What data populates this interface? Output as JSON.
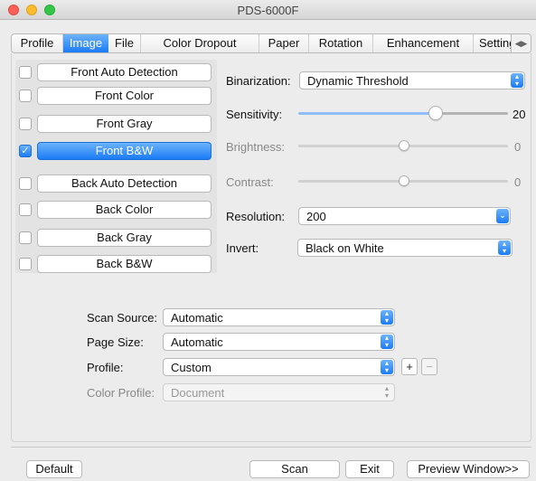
{
  "window": {
    "title": "PDS-6000F",
    "traffic_lights": {
      "close": "#fc5f57",
      "minimize": "#fdbc2e",
      "maximize": "#33c748"
    }
  },
  "tabs": [
    {
      "label": "Profile",
      "active": false
    },
    {
      "label": "Image",
      "active": true
    },
    {
      "label": "File",
      "active": false
    },
    {
      "label": "Color Dropout",
      "active": false
    },
    {
      "label": "Paper",
      "active": false
    },
    {
      "label": "Rotation",
      "active": false
    },
    {
      "label": "Enhancement",
      "active": false
    },
    {
      "label": "Setting",
      "active": false
    }
  ],
  "tab_scroll": "◀▶",
  "image_modes": [
    {
      "label": "Front Auto Detection",
      "checked": false,
      "selected": false
    },
    {
      "label": "Front Color",
      "checked": false,
      "selected": false
    },
    {
      "label": "Front Gray",
      "checked": false,
      "selected": false
    },
    {
      "label": "Front B&W",
      "checked": true,
      "selected": true
    },
    {
      "label": "Back Auto Detection",
      "checked": false,
      "selected": false
    },
    {
      "label": "Back Color",
      "checked": false,
      "selected": false
    },
    {
      "label": "Back Gray",
      "checked": false,
      "selected": false
    },
    {
      "label": "Back B&W",
      "checked": false,
      "selected": false
    }
  ],
  "settings": {
    "binarization": {
      "label": "Binarization:",
      "value": "Dynamic Threshold"
    },
    "sensitivity": {
      "label": "Sensitivity:",
      "value": "20",
      "level": 0.6
    },
    "brightness": {
      "label": "Brightness:",
      "value": "0",
      "level": 0.5,
      "enabled": false
    },
    "contrast": {
      "label": "Contrast:",
      "value": "0",
      "level": 0.5,
      "enabled": false
    },
    "resolution": {
      "label": "Resolution:",
      "value": "200"
    },
    "invert": {
      "label": "Invert:",
      "value": "Black on White"
    }
  },
  "scan_options": {
    "scan_source": {
      "label": "Scan Source:",
      "value": "Automatic"
    },
    "page_size": {
      "label": "Page Size:",
      "value": "Automatic"
    },
    "profile": {
      "label": "Profile:",
      "value": "Custom",
      "add": "+",
      "remove": "−"
    },
    "color_profile": {
      "label": "Color Profile:",
      "value": "Document",
      "enabled": false
    }
  },
  "footer": {
    "default": "Default",
    "scan": "Scan",
    "exit": "Exit",
    "preview": "Preview Window>>"
  },
  "colors": {
    "accent": "#1b7bf5",
    "accent_light": "#6cb3fa",
    "window_bg": "#ececec"
  }
}
